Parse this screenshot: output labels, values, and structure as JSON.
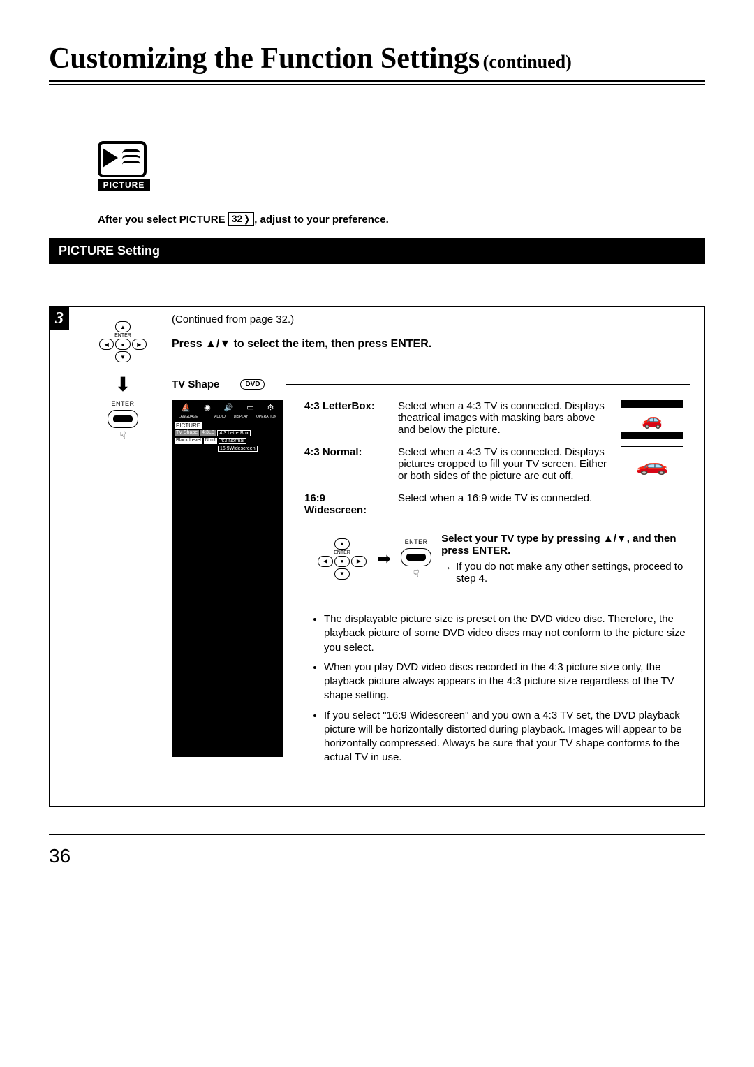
{
  "title_main": "Customizing the Function Settings",
  "title_cont": "(continued)",
  "picture_icon_caption": "PICTURE",
  "intro_pre": "After you select PICTURE ",
  "intro_ref": "32",
  "intro_post": ", adjust to your preference.",
  "section_bar": "PICTURE Setting",
  "step_number": "3",
  "continued_from": "(Continued from page 32.)",
  "instruction": "Press ▲/▼ to select the item, then press ENTER.",
  "left_enter_label": "ENTER",
  "tv_shape_label": "TV Shape",
  "dvd_pill": "DVD",
  "menu": {
    "icon_labels": [
      "LANGUAGE",
      "",
      "AUDIO",
      "DISPLAY",
      "OPERATION"
    ],
    "header": "PICTURE",
    "rows": [
      {
        "c1": "TV Shape",
        "c2": "4:3LB",
        "c3": "4:3 LetterBox"
      },
      {
        "c1": "Black Level",
        "c2": "Nrml",
        "c3": "4:3 Normal"
      },
      {
        "c1": "",
        "c2": "",
        "c3": "16:9Widescreen"
      }
    ]
  },
  "options": [
    {
      "name": "4:3 LetterBox:",
      "desc": "Select when a 4:3 TV is connected. Displays theatrical images with masking bars above and below the picture."
    },
    {
      "name": "4:3 Normal:",
      "desc": "Select when a 4:3 TV is connected. Displays pictures cropped to fill your TV screen. Either or both sides of the picture are cut off."
    },
    {
      "name": "16:9 Widescreen:",
      "desc": "Select when a 16:9 wide TV is connected."
    }
  ],
  "select_enter_label": "ENTER",
  "select_bold": "Select your TV type by pressing ▲/▼, and then press ENTER.",
  "select_note": "If you do not make any other settings, proceed to step 4.",
  "arrow_sym": "→",
  "notes": [
    "The displayable picture size is preset on the DVD video disc. Therefore, the playback picture of some DVD video discs may not conform to the picture size you select.",
    "When you play DVD video discs recorded in the 4:3 picture size only, the playback picture always appears in the 4:3 picture size regardless of the TV shape setting.",
    "If you select \"16:9 Widescreen\" and you own a 4:3 TV set, the DVD playback picture will be horizontally distorted during playback. Images will appear to be horizontally compressed. Always be sure that your TV shape conforms to the actual TV in use."
  ],
  "page_number": "36"
}
